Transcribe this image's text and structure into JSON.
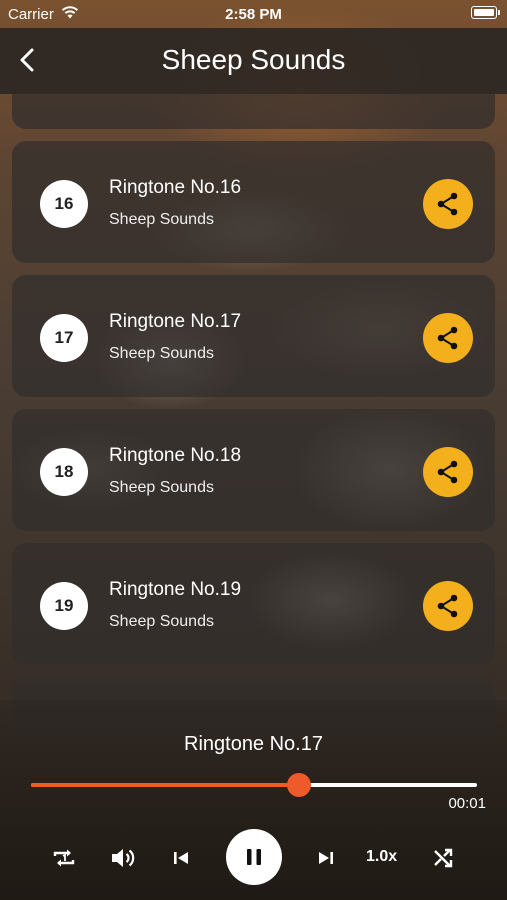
{
  "status": {
    "carrier": "Carrier",
    "time": "2:58 PM"
  },
  "header": {
    "title": "Sheep Sounds"
  },
  "items": [
    {
      "number": "16",
      "title": "Ringtone No.16",
      "subtitle": "Sheep Sounds"
    },
    {
      "number": "17",
      "title": "Ringtone No.17",
      "subtitle": "Sheep Sounds"
    },
    {
      "number": "18",
      "title": "Ringtone No.18",
      "subtitle": "Sheep Sounds"
    },
    {
      "number": "19",
      "title": "Ringtone No.19",
      "subtitle": "Sheep Sounds"
    }
  ],
  "player": {
    "now_playing": "Ringtone No.17",
    "elapsed": "00:01",
    "progress_fraction": 0.6,
    "speed": "1.0x"
  },
  "colors": {
    "accent": "#ee5a29",
    "share_button": "#f3b01c"
  },
  "icons": [
    "back-chevron-icon",
    "share-icon",
    "repeat-one-icon",
    "volume-icon",
    "previous-icon",
    "pause-icon",
    "next-icon",
    "shuffle-icon",
    "wifi-icon",
    "battery-icon"
  ]
}
